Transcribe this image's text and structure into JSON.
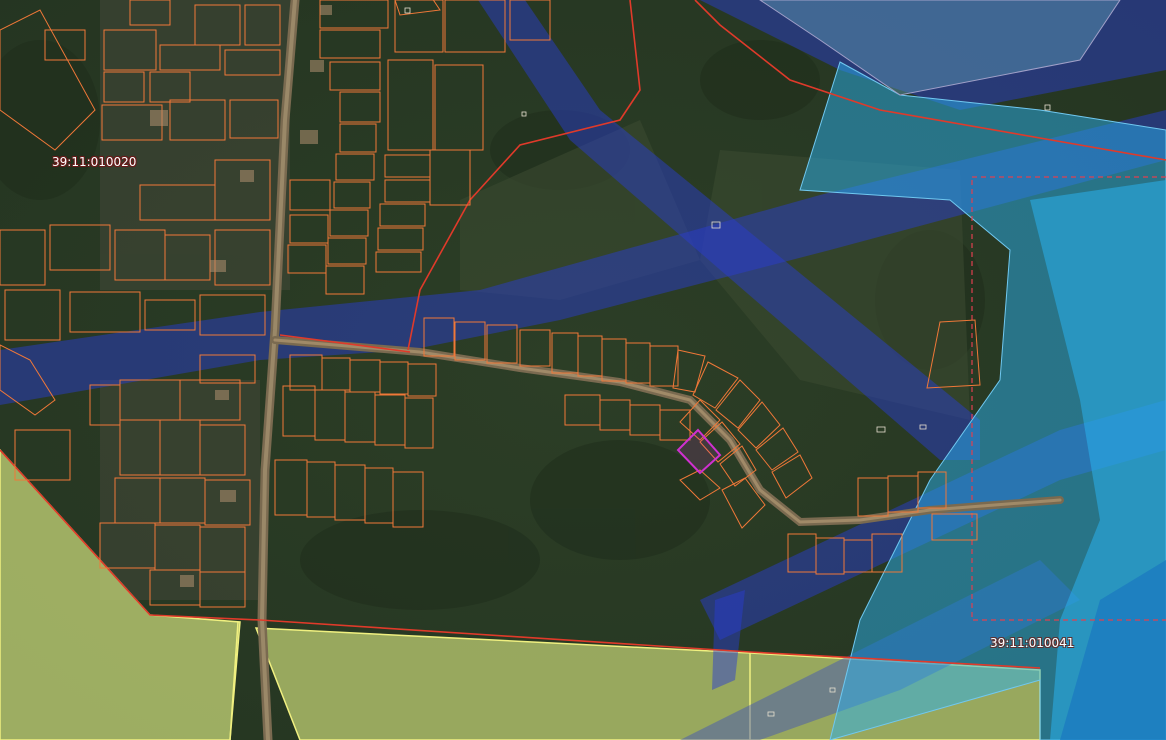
{
  "map": {
    "cadastral_quarters": [
      {
        "number": "39:11:010020"
      },
      {
        "number": "39:11:010041"
      }
    ],
    "colors": {
      "quarter_boundary": "#e03a2a",
      "parcel_outline": "#f07838",
      "selected_parcel": "#c832c8",
      "zone_blue": "#2a3cc8",
      "zone_cyan": "#2aa8e8",
      "farmland_fill": "#c8d878",
      "farmland_outline": "#f0f080",
      "background_forest": "#2f4128"
    }
  }
}
